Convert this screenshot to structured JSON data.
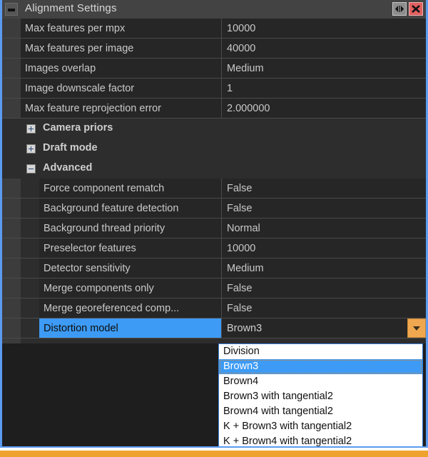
{
  "window": {
    "title": "Alignment Settings",
    "collapse_icon": "minus-icon",
    "float_icon": "left-right-arrows-icon",
    "close_icon": "close-x-icon",
    "accent_blue": "#5b9bf0",
    "accent_orange": "#f0a850",
    "selection_blue": "#3d9bf5"
  },
  "properties": [
    {
      "label": "Max features per mpx",
      "value": "10000",
      "level": 1
    },
    {
      "label": "Max features per image",
      "value": "40000",
      "level": 1
    },
    {
      "label": "Images overlap",
      "value": "Medium",
      "level": 1
    },
    {
      "label": "Image downscale factor",
      "value": "1",
      "level": 1
    },
    {
      "label": "Max feature reprojection error",
      "value": "2.000000",
      "level": 1
    }
  ],
  "groups": [
    {
      "label": "Camera priors",
      "expanded": false,
      "expander_icon": "plus-box-icon"
    },
    {
      "label": "Draft mode",
      "expanded": false,
      "expander_icon": "plus-box-icon"
    },
    {
      "label": "Advanced",
      "expanded": true,
      "expander_icon": "minus-box-icon"
    }
  ],
  "advanced_properties": [
    {
      "label": "Force component rematch",
      "value": "False",
      "level": 2
    },
    {
      "label": "Background feature detection",
      "value": "False",
      "level": 2
    },
    {
      "label": "Background thread priority",
      "value": "Normal",
      "level": 2
    },
    {
      "label": "Preselector features",
      "value": "10000",
      "level": 2
    },
    {
      "label": "Detector sensitivity",
      "value": "Medium",
      "level": 2
    },
    {
      "label": "Merge components only",
      "value": "False",
      "level": 2
    },
    {
      "label": "Merge georeferenced comp...",
      "value": "False",
      "level": 2
    }
  ],
  "selected_property": {
    "label": "Distortion model",
    "value": "Brown3",
    "dropdown_icon": "chevron-down-icon"
  },
  "dropdown": {
    "open": true,
    "selected_index": 1,
    "options": [
      "Division",
      "Brown3",
      "Brown4",
      "Brown3 with tangential2",
      "Brown4 with tangential2",
      "K + Brown3 with tangential2",
      "K + Brown4 with tangential2"
    ]
  }
}
